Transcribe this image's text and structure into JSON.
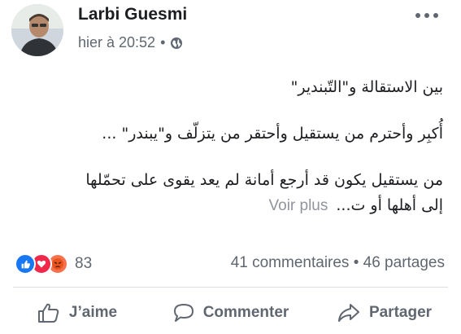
{
  "post": {
    "author": "Larbi Guesmi",
    "timestamp": "hier à 20:52",
    "separator": "•",
    "privacy_icon": "globe-icon",
    "lines": [
      "بين الاستقالة و\"التّبندير\"",
      "أُكبِر وأحترم من يستقيل وأحتقر من يتزلّف و\"يبندر\" ...",
      "من يستقيل يكون قد أرجع أمانة لم يعد يقوى على تحمّلها",
      "إلى أهلها أو ت..."
    ],
    "see_more": "Voir plus"
  },
  "stats": {
    "reactions": [
      "like",
      "love",
      "angry"
    ],
    "reaction_count": "83",
    "comments_shares": "41 commentaires • 46 partages"
  },
  "actions": {
    "like": "J’aime",
    "comment": "Commenter",
    "share": "Partager"
  },
  "colors": {
    "like": "#1877f2",
    "love": "#f0284a",
    "angry": "#f7714c",
    "secondary_text": "#606770"
  }
}
